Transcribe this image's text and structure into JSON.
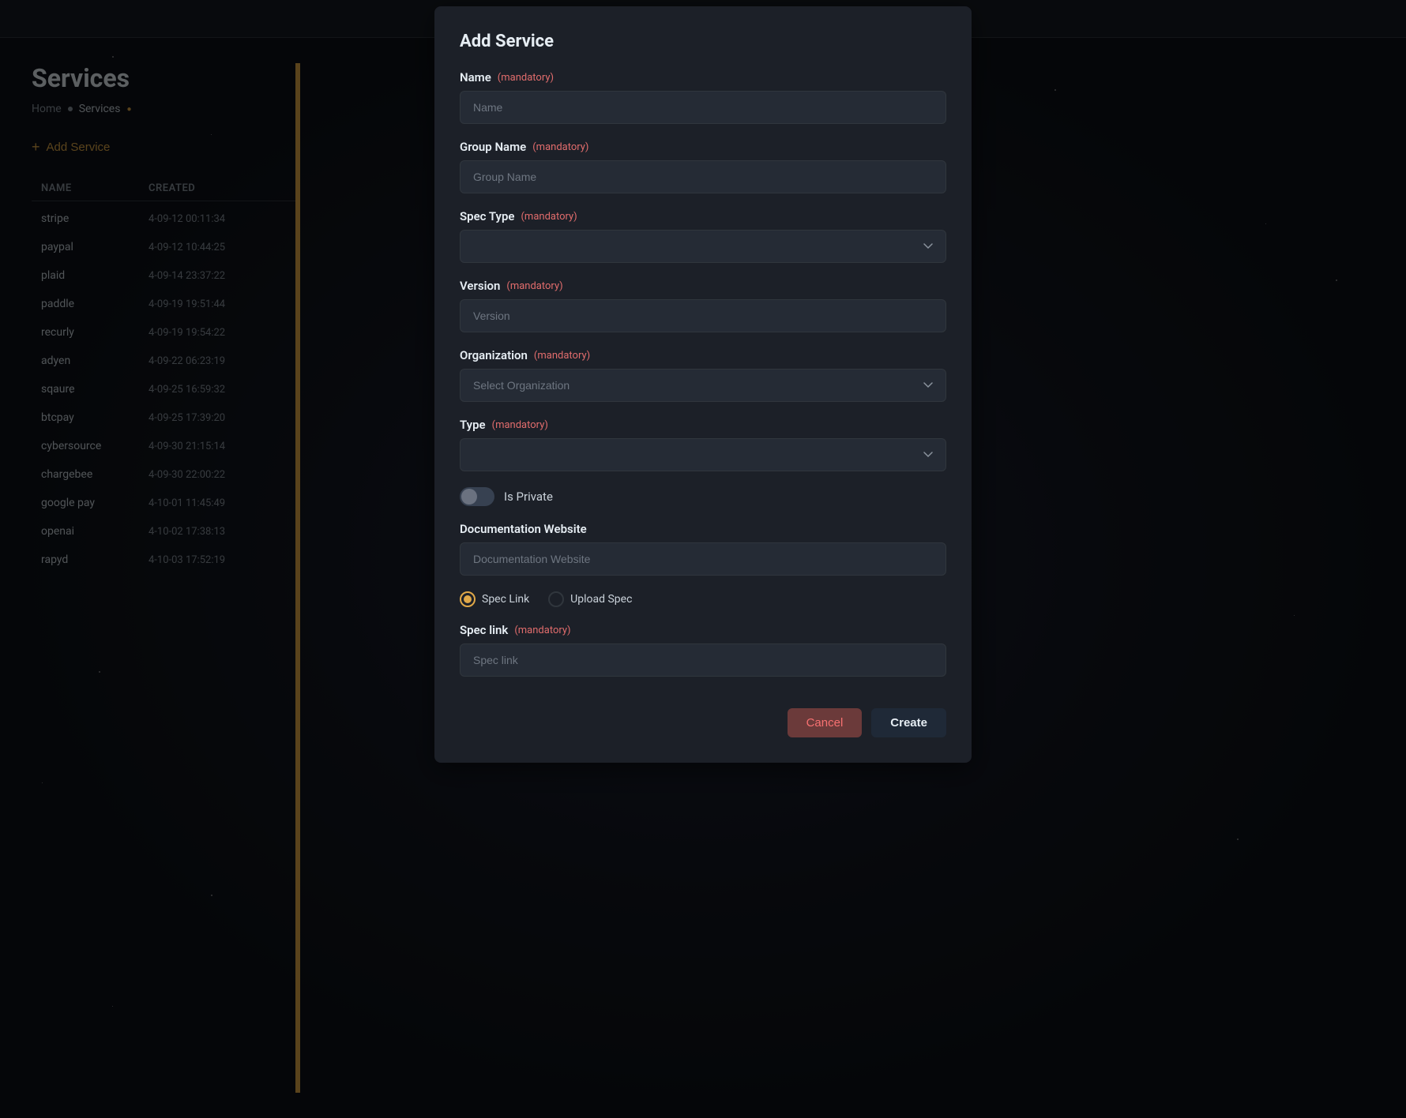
{
  "page": {
    "title": "Services",
    "breadcrumb": {
      "home": "Home",
      "separator": "•",
      "current": "Services"
    },
    "add_service_btn": "Add Service",
    "table_headers": {
      "name": "Name",
      "created": "Created"
    }
  },
  "services": [
    {
      "name": "stripe",
      "created": "4-09-12 00:11:34"
    },
    {
      "name": "paypal",
      "created": "4-09-12 10:44:25"
    },
    {
      "name": "plaid",
      "created": "4-09-14 23:37:22"
    },
    {
      "name": "paddle",
      "created": "4-09-19 19:51:44"
    },
    {
      "name": "recurly",
      "created": "4-09-19 19:54:22"
    },
    {
      "name": "adyen",
      "created": "4-09-22 06:23:19"
    },
    {
      "name": "sqaure",
      "created": "4-09-25 16:59:32"
    },
    {
      "name": "btcpay",
      "created": "4-09-25 17:39:20"
    },
    {
      "name": "cybersource",
      "created": "4-09-30 21:15:14"
    },
    {
      "name": "chargebee",
      "created": "4-09-30 22:00:22"
    },
    {
      "name": "google pay",
      "created": "4-10-01 11:45:49"
    },
    {
      "name": "openai",
      "created": "4-10-02 17:38:13"
    },
    {
      "name": "rapyd",
      "created": "4-10-03 17:52:19"
    }
  ],
  "modal": {
    "title": "Add Service",
    "fields": {
      "name": {
        "label": "Name",
        "mandatory": "(mandatory)",
        "placeholder": "Name"
      },
      "group_name": {
        "label": "Group Name",
        "mandatory": "(mandatory)",
        "placeholder": "Group Name"
      },
      "spec_type": {
        "label": "Spec Type",
        "mandatory": "(mandatory)",
        "placeholder": ""
      },
      "version": {
        "label": "Version",
        "mandatory": "(mandatory)",
        "placeholder": "Version"
      },
      "organization": {
        "label": "Organization",
        "mandatory": "(mandatory)",
        "placeholder": "Select Organization"
      },
      "type": {
        "label": "Type",
        "mandatory": "(mandatory)",
        "placeholder": ""
      },
      "is_private": {
        "label": "Is Private"
      },
      "documentation_website": {
        "label": "Documentation Website",
        "placeholder": "Documentation Website"
      },
      "spec_link": {
        "label": "Spec link",
        "mandatory": "(mandatory)",
        "placeholder": "Spec link"
      }
    },
    "radio_options": {
      "spec_link": "Spec Link",
      "upload_spec": "Upload Spec"
    },
    "buttons": {
      "cancel": "Cancel",
      "create": "Create"
    }
  }
}
